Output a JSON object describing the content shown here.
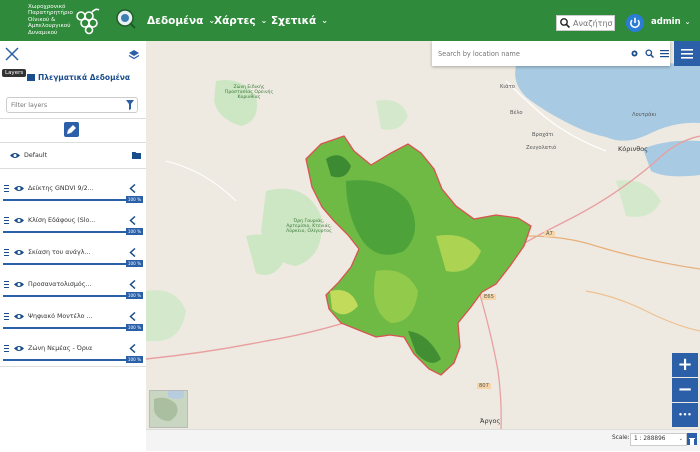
{
  "header": {
    "org_title": "Χωροχρονικό Παρατηρητήριο Οίνικού & Αμπελουργικού Δυναμικού",
    "logo_icon": "grape-cluster-icon",
    "logo2_icon": "observatory-globe-icon",
    "menu": [
      {
        "label": "Δεδομένα"
      },
      {
        "label": "Χάρτες"
      },
      {
        "label": "Σχετικά"
      }
    ],
    "search_placeholder": "Αναζήτησ",
    "user": "admin"
  },
  "panel": {
    "tooltip": "Layers",
    "title": "Πλεγματικά Δεδομένα",
    "filter_placeholder": "Filter layers",
    "group": {
      "label": "Default"
    },
    "layers": [
      {
        "label": "Δείκτης GNDVI 9/2...",
        "opacity": "100 %"
      },
      {
        "label": "Κλίση Εδάφους (Slo...",
        "opacity": "100 %"
      },
      {
        "label": "Σκίαση του ανάγλ...",
        "opacity": "100 %"
      },
      {
        "label": "Προσανατολισμός...",
        "opacity": "100 %"
      },
      {
        "label": "Ψηφιακό Μοντέλο ...",
        "opacity": "100 %"
      },
      {
        "label": "Ζώνη Νεμέας - Όρια",
        "opacity": "100 %"
      }
    ]
  },
  "map": {
    "search_placeholder": "Search by location name",
    "places": {
      "kiato": "Κιάτο",
      "velo": "Βέλο",
      "vrachati": "Βραχάτι",
      "zevgolatio": "Ζευγολατιό",
      "korinthos": "Κόρινθος",
      "loutraki": "Λουτράκι",
      "argos": "Άργος",
      "natura1": "Ζώνη Ειδικής Προστασίας Ορεινής Κορινθίας",
      "natura2": "Όρη Γαυριάς, Αρτεμίσιο, Κτενιάς, Λύρκειο, Ολίγυρτος",
      "road_a7": "A7",
      "road_e65": "E65",
      "road_807": "807"
    },
    "zoom_in": "+",
    "zoom_out": "−",
    "more": "•••"
  },
  "footer": {
    "scale_label": "Scale:",
    "scale_value": "1 : 288896"
  }
}
